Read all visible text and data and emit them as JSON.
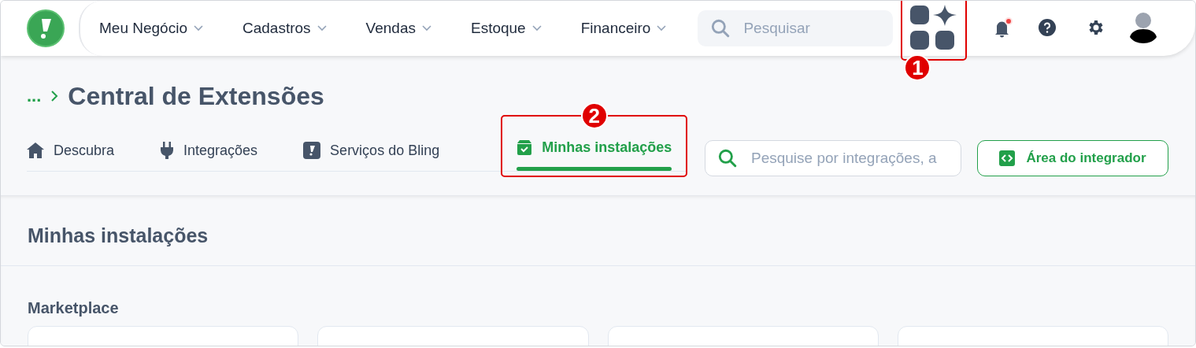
{
  "nav": [
    {
      "label": "Meu Negócio"
    },
    {
      "label": "Cadastros"
    },
    {
      "label": "Vendas"
    },
    {
      "label": "Estoque"
    },
    {
      "label": "Financeiro"
    }
  ],
  "search": {
    "placeholder": "Pesquisar"
  },
  "apps_button": {
    "callout": "1"
  },
  "notifications": {
    "unread": true
  },
  "breadcrumb": {
    "ellipsis": "...",
    "title": "Central de Extensões"
  },
  "tabs": [
    {
      "label": "Descubra",
      "kind": "home",
      "selected": false
    },
    {
      "label": "Integrações",
      "kind": "plug",
      "selected": false
    },
    {
      "label": "Serviços do Bling",
      "kind": "brand",
      "selected": false
    },
    {
      "label": "Minhas instalações",
      "kind": "box",
      "selected": true,
      "callout": "2"
    }
  ],
  "extension_search": {
    "placeholder": "Pesquise por integrações, a"
  },
  "integrator_button": {
    "label": "Área do integrador"
  },
  "section": {
    "title": "Minhas instalações",
    "group": "Marketplace",
    "cards": [
      {
        "kind": "card"
      },
      {
        "kind": "card"
      },
      {
        "kind": "card"
      },
      {
        "kind": "card"
      }
    ]
  }
}
